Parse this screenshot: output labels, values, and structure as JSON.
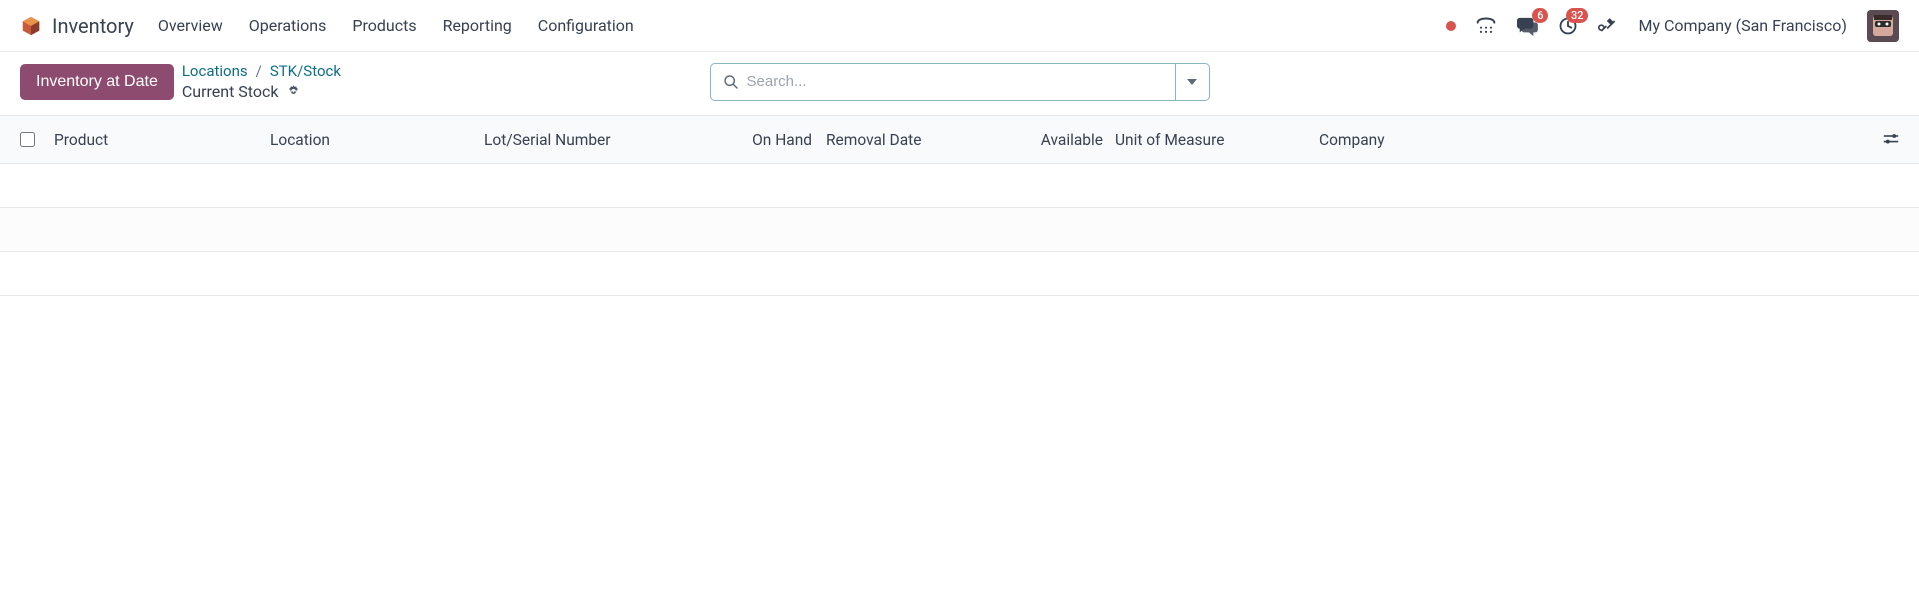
{
  "app": {
    "title": "Inventory"
  },
  "nav": {
    "items": [
      {
        "label": "Overview"
      },
      {
        "label": "Operations"
      },
      {
        "label": "Products"
      },
      {
        "label": "Reporting"
      },
      {
        "label": "Configuration"
      }
    ]
  },
  "header_right": {
    "messages_badge": "6",
    "activities_badge": "32",
    "company": "My Company (San Francisco)"
  },
  "subheader": {
    "button_label": "Inventory at Date",
    "breadcrumb": {
      "locations": "Locations",
      "stk_stock": "STK/Stock"
    },
    "page_title": "Current Stock",
    "search_placeholder": "Search..."
  },
  "table": {
    "columns": {
      "product": "Product",
      "location": "Location",
      "lot": "Lot/Serial Number",
      "on_hand": "On Hand",
      "removal_date": "Removal Date",
      "available": "Available",
      "uom": "Unit of Measure",
      "company": "Company"
    }
  }
}
